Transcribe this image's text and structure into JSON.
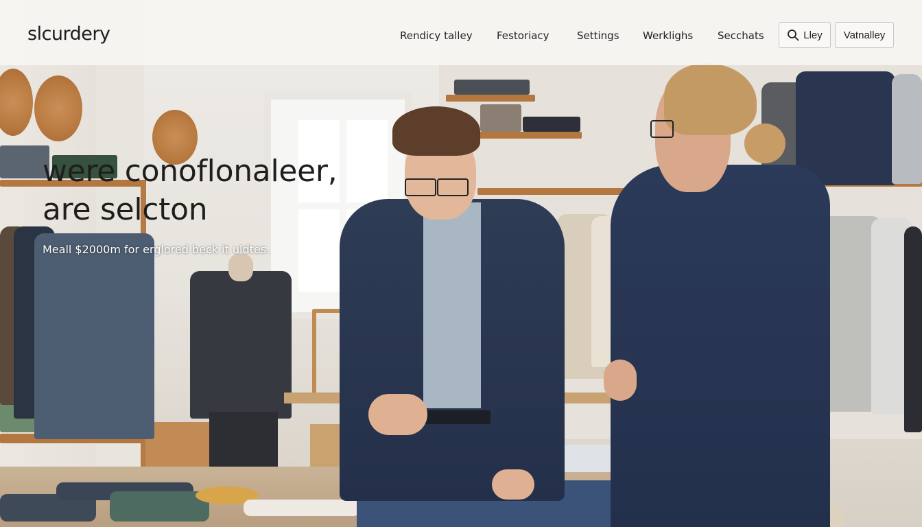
{
  "brand": {
    "logo_text": "slcurdery"
  },
  "nav": {
    "links": [
      {
        "label": "Rendicy talley"
      },
      {
        "label": "Festoriacy"
      },
      {
        "label": "Settings"
      },
      {
        "label": "Werklighs"
      },
      {
        "label": "Secchats"
      }
    ],
    "search_button": {
      "label": "Lley",
      "icon": "search-icon"
    },
    "account_button": {
      "label": "Vatnalley"
    }
  },
  "hero": {
    "title_line1": "were conoflonaleer,",
    "title_line2": "are selcton",
    "subtitle": "Meall $2000m for erglored beck it uldtes."
  },
  "colors": {
    "nav_background": "#f6f5f2",
    "text_primary": "#1e1e1e",
    "suit_navy": "#2a3a56"
  }
}
